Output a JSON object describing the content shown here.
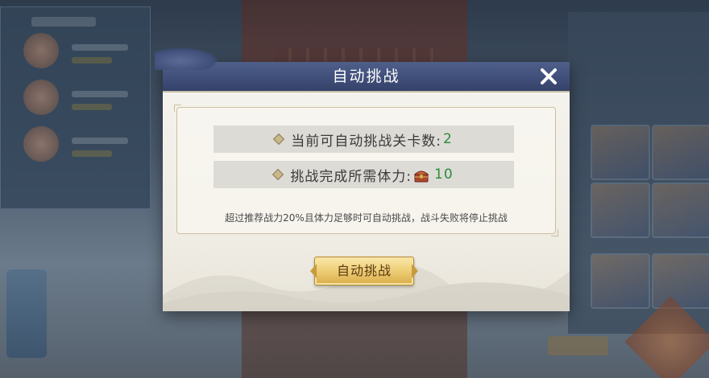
{
  "dialog": {
    "title": "自动挑战",
    "close_icon": "close-icon",
    "rows": [
      {
        "label": "当前可自动挑战关卡数:",
        "value": "2"
      },
      {
        "label": "挑战完成所需体力:",
        "icon": "treasure-chest-icon",
        "value": "10"
      }
    ],
    "note": "超过推荐战力20%且体力足够时可自动挑战，战斗失败将停止挑战",
    "button_label": "自动挑战"
  },
  "colors": {
    "header": "#3f4e78",
    "value_green": "#2f8a3a",
    "button_gold": "#efd07a",
    "body_bg": "#f2f0ea"
  }
}
